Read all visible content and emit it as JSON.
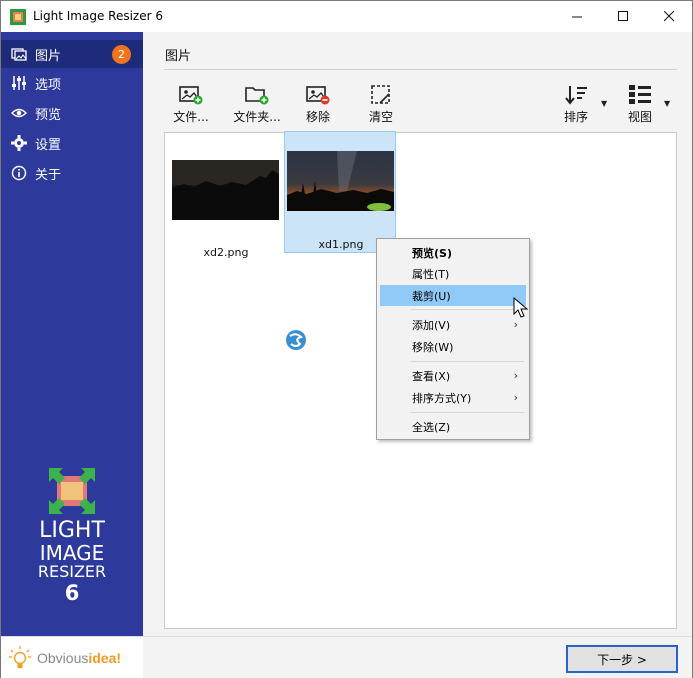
{
  "window": {
    "title": "Light Image Resizer 6"
  },
  "titlebar_buttons": {
    "minimize": "—",
    "maximize": "☐",
    "close": "✕"
  },
  "sidebar": {
    "items": [
      {
        "label": "图片",
        "icon": "images-icon",
        "badge": "2",
        "active": true
      },
      {
        "label": "选项",
        "icon": "sliders-icon"
      },
      {
        "label": "预览",
        "icon": "eye-icon"
      },
      {
        "label": "设置",
        "icon": "gear-icon"
      },
      {
        "label": "关于",
        "icon": "info-icon"
      }
    ],
    "logo": {
      "line1": "LIGHT",
      "line2": "IMAGE",
      "line3": "RESIZER",
      "line4": "6"
    },
    "footer": {
      "brand_part1": "Obvious",
      "brand_part2": "idea!"
    }
  },
  "main": {
    "title": "图片",
    "toolbar": {
      "add_file": "文件...",
      "add_folder": "文件夹...",
      "remove": "移除",
      "clear": "清空",
      "sort": "排序",
      "view": "视图"
    },
    "images": [
      {
        "name": "xd2.png",
        "selected": false
      },
      {
        "name": "xd1.png",
        "selected": true
      }
    ]
  },
  "context_menu": {
    "items": [
      {
        "label": "预览(S)",
        "bold": true
      },
      {
        "label": "属性(T)"
      },
      {
        "label": "裁剪(U)",
        "hover": true
      },
      {
        "label": "添加(V)",
        "submenu": true
      },
      {
        "label": "移除(W)"
      },
      {
        "label": "查看(X)",
        "submenu": true
      },
      {
        "label": "排序方式(Y)",
        "submenu": true
      },
      {
        "label": "全选(Z)"
      }
    ],
    "submenu_arrow": "›"
  },
  "bottom": {
    "next_button": "下一步 >"
  },
  "colors": {
    "sidebar": "#2d3a9b",
    "accent": "#f0731e",
    "selection": "#cce4f7",
    "menu_hover": "#91c9f7"
  }
}
